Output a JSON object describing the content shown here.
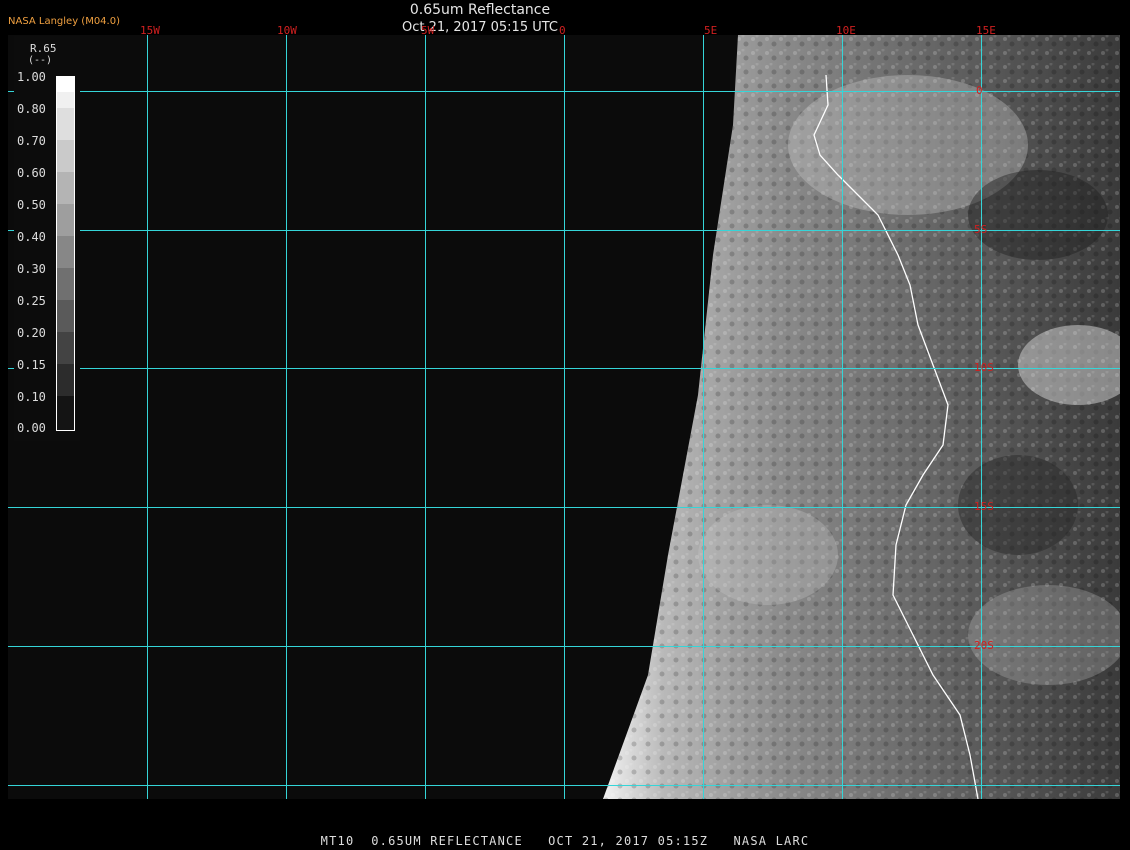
{
  "header": {
    "title": "0.65um Reflectance",
    "subtitle": "Oct 21, 2017 05:15 UTC",
    "brand": "NASA Langley (M04.0)"
  },
  "map": {
    "longitude_labels": [
      "15W",
      "10W",
      "5W",
      "0",
      "5E",
      "10E",
      "15E"
    ],
    "latitude_labels": [
      "0",
      "5S",
      "10S",
      "15S",
      "20S"
    ],
    "grid_color": "#35d5d8",
    "label_color": "#d02020"
  },
  "legend": {
    "title": "R.65",
    "unit": "(--)",
    "ticks": [
      "1.00",
      "0.80",
      "0.70",
      "0.60",
      "0.50",
      "0.40",
      "0.30",
      "0.25",
      "0.20",
      "0.15",
      "0.10",
      "0.00"
    ]
  },
  "footer": {
    "text": "MT10  0.65UM REFLECTANCE   OCT 21, 2017 05:15Z   NASA LARC"
  }
}
